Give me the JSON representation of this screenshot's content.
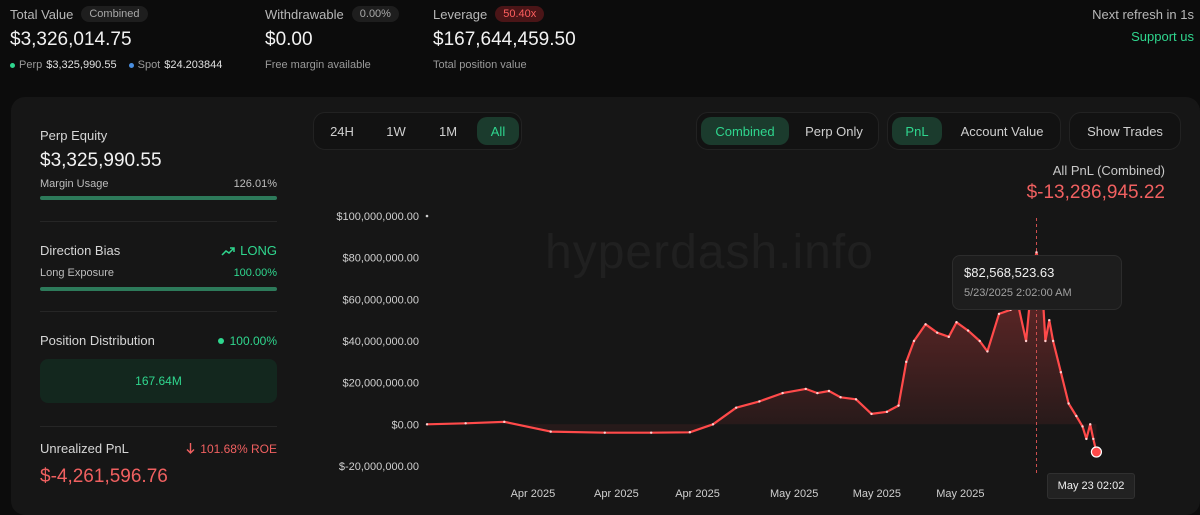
{
  "header": {
    "total_value": {
      "label": "Total Value",
      "badge": "Combined",
      "value": "$3,326,014.75",
      "perp_label": "Perp",
      "perp_value": "$3,325,990.55",
      "spot_label": "Spot",
      "spot_value": "$24.203844"
    },
    "withdrawable": {
      "label": "Withdrawable",
      "badge": "0.00%",
      "value": "$0.00",
      "sub": "Free margin available"
    },
    "leverage": {
      "label": "Leverage",
      "badge": "50.40x",
      "value": "$167,644,459.50",
      "sub": "Total position value"
    },
    "refresh": "Next refresh in 1s",
    "support": "Support us"
  },
  "sidebar": {
    "perp_equity": {
      "label": "Perp Equity",
      "value": "$3,325,990.55",
      "margin_label": "Margin Usage",
      "margin_value": "126.01%",
      "margin_fraction": 1.0
    },
    "direction": {
      "label": "Direction Bias",
      "bias": "LONG",
      "exposure_label": "Long Exposure",
      "exposure_value": "100.00%",
      "exposure_fraction": 1.0
    },
    "distribution": {
      "label": "Position Distribution",
      "percent": "100.00%",
      "bar_value": "167.64M"
    },
    "unrealized": {
      "label": "Unrealized PnL",
      "roe": "101.68% ROE",
      "value": "$-4,261,596.76"
    }
  },
  "controls": {
    "ranges": [
      "24H",
      "1W",
      "1M",
      "All"
    ],
    "active_range": "All",
    "modes": [
      "Combined",
      "Perp Only"
    ],
    "active_mode": "Combined",
    "metrics": [
      "PnL",
      "Account Value"
    ],
    "active_metric": "PnL",
    "show_trades": "Show Trades"
  },
  "chart_header": {
    "title": "All PnL (Combined)",
    "value": "$-13,286,945.22"
  },
  "watermark": "hyperdash.info",
  "colors": {
    "green": "#2fd68e",
    "red": "#f06060",
    "line": "#ff4a4a"
  },
  "chart_data": {
    "type": "area",
    "y_tick_labels": [
      "$100,000,000.00",
      "$80,000,000.00",
      "$60,000,000.00",
      "$40,000,000.00",
      "$20,000,000.00",
      "$0.00",
      "$-20,000,000.00"
    ],
    "y_ticks": [
      100000000,
      80000000,
      60000000,
      40000000,
      20000000,
      0,
      -20000000
    ],
    "ylim": [
      -20000000,
      100000000
    ],
    "x_tick_labels": [
      "Apr 2025",
      "Apr 2025",
      "Apr 2025",
      "May 2025",
      "May 2025",
      "May 2025"
    ],
    "x_ticks": [
      0.137,
      0.245,
      0.35,
      0.475,
      0.582,
      0.69
    ],
    "xlim": [
      0,
      1
    ],
    "grid": false,
    "series": [
      {
        "points": [
          [
            0.0,
            0
          ],
          [
            0.05,
            500000
          ],
          [
            0.1,
            1200000
          ],
          [
            0.16,
            -3500000
          ],
          [
            0.23,
            -4000000
          ],
          [
            0.29,
            -4000000
          ],
          [
            0.34,
            -3800000
          ],
          [
            0.37,
            0
          ],
          [
            0.4,
            8000000
          ],
          [
            0.43,
            11000000
          ],
          [
            0.46,
            15000000
          ],
          [
            0.49,
            17000000
          ],
          [
            0.505,
            15000000
          ],
          [
            0.52,
            16000000
          ],
          [
            0.535,
            13000000
          ],
          [
            0.555,
            12000000
          ],
          [
            0.575,
            5000000
          ],
          [
            0.595,
            6000000
          ],
          [
            0.61,
            9000000
          ],
          [
            0.62,
            30000000
          ],
          [
            0.63,
            40000000
          ],
          [
            0.645,
            48000000
          ],
          [
            0.66,
            44000000
          ],
          [
            0.675,
            42000000
          ],
          [
            0.685,
            49000000
          ],
          [
            0.7,
            45000000
          ],
          [
            0.715,
            40000000
          ],
          [
            0.725,
            35000000
          ],
          [
            0.74,
            53000000
          ],
          [
            0.755,
            55000000
          ],
          [
            0.765,
            57000000
          ],
          [
            0.775,
            40000000
          ],
          [
            0.784,
            75000000
          ],
          [
            0.7885,
            82568523.63
          ],
          [
            0.795,
            72000000
          ],
          [
            0.8,
            40000000
          ],
          [
            0.805,
            50000000
          ],
          [
            0.81,
            40000000
          ],
          [
            0.82,
            25000000
          ],
          [
            0.83,
            10000000
          ],
          [
            0.84,
            4000000
          ],
          [
            0.848,
            -1000000
          ],
          [
            0.853,
            -7000000
          ],
          [
            0.858,
            0
          ],
          [
            0.862,
            -7000000
          ],
          [
            0.866,
            -13286945.22
          ]
        ]
      }
    ],
    "tooltip": {
      "value": "$82,568,523.63",
      "time": "5/23/2025 2:02:00 AM",
      "axis_label": "May 23 02:02"
    }
  }
}
